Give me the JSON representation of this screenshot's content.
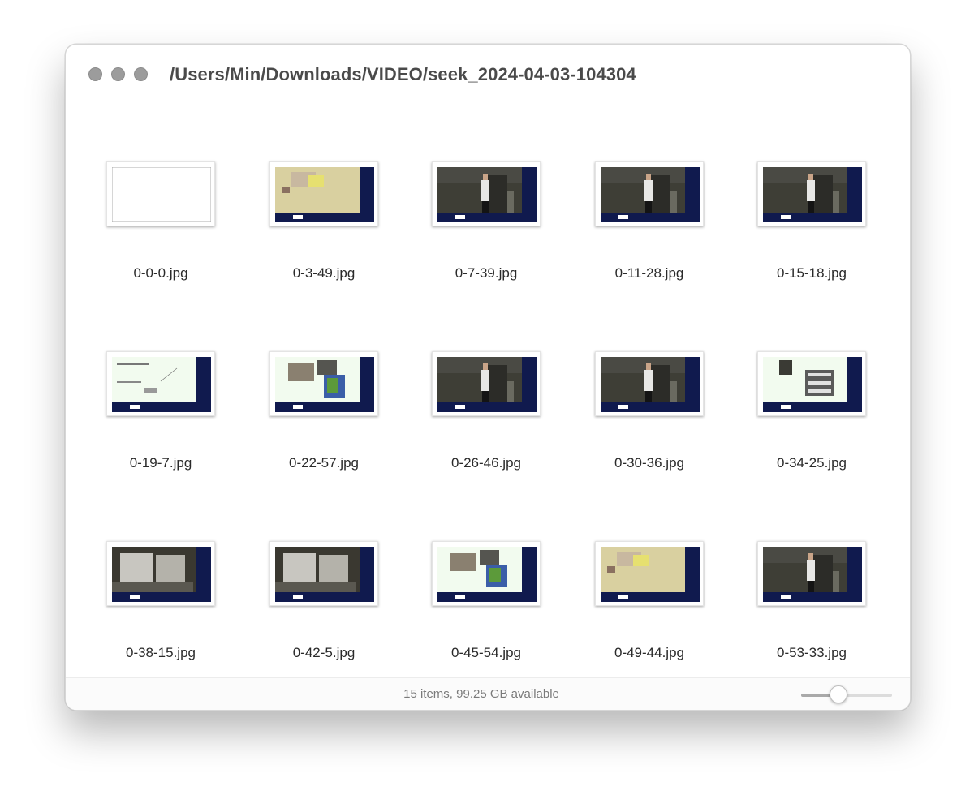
{
  "window": {
    "title": "/Users/Min/Downloads/VIDEO/seek_2024-04-03-104304"
  },
  "files": [
    {
      "name": "0-0-0.jpg",
      "kind": "blank"
    },
    {
      "name": "0-3-49.jpg",
      "kind": "hands-table"
    },
    {
      "name": "0-7-39.jpg",
      "kind": "lecturer"
    },
    {
      "name": "0-11-28.jpg",
      "kind": "lecturer"
    },
    {
      "name": "0-15-18.jpg",
      "kind": "lecturer"
    },
    {
      "name": "0-19-7.jpg",
      "kind": "slide-diagram"
    },
    {
      "name": "0-22-57.jpg",
      "kind": "slide-images"
    },
    {
      "name": "0-26-46.jpg",
      "kind": "lecturer"
    },
    {
      "name": "0-30-36.jpg",
      "kind": "lecturer"
    },
    {
      "name": "0-34-25.jpg",
      "kind": "slide-pattern"
    },
    {
      "name": "0-38-15.jpg",
      "kind": "hands-paper"
    },
    {
      "name": "0-42-5.jpg",
      "kind": "hands-paper"
    },
    {
      "name": "0-45-54.jpg",
      "kind": "slide-images"
    },
    {
      "name": "0-49-44.jpg",
      "kind": "hands-table"
    },
    {
      "name": "0-53-33.jpg",
      "kind": "lecturer"
    }
  ],
  "status": {
    "text": "15 items, 99.25 GB available"
  },
  "zoom_slider": {
    "value_fraction": 0.41
  },
  "colors": {
    "sidebar_navy": "#101a4e",
    "traffic_light": "#9c9c9c"
  }
}
